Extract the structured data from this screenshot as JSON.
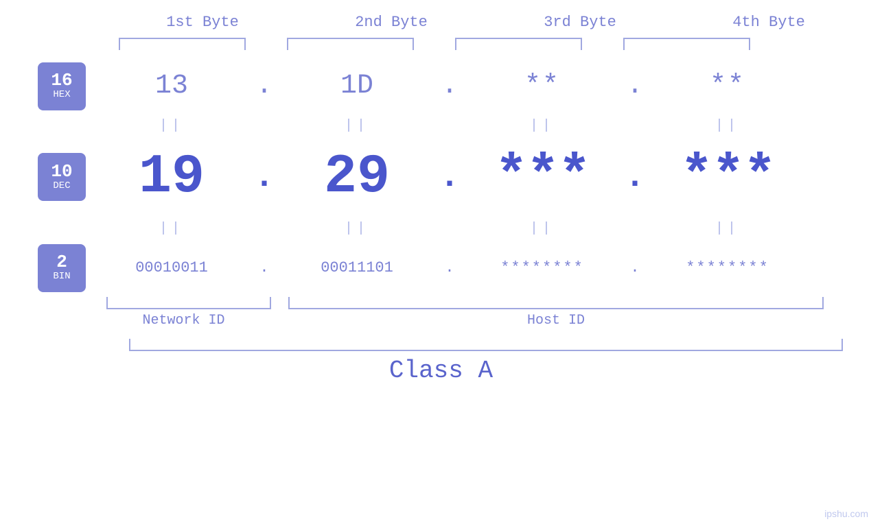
{
  "headers": {
    "byte1": "1st Byte",
    "byte2": "2nd Byte",
    "byte3": "3rd Byte",
    "byte4": "4th Byte"
  },
  "badges": {
    "hex": {
      "num": "16",
      "label": "HEX"
    },
    "dec": {
      "num": "10",
      "label": "DEC"
    },
    "bin": {
      "num": "2",
      "label": "BIN"
    }
  },
  "hex_row": {
    "b1": "13",
    "b2": "1D",
    "b3": "**",
    "b4": "**",
    "dot": "."
  },
  "dec_row": {
    "b1": "19",
    "b2": "29",
    "b3": "***",
    "b4": "***",
    "dot": "."
  },
  "bin_row": {
    "b1": "00010011",
    "b2": "00011101",
    "b3": "********",
    "b4": "********",
    "dot": "."
  },
  "labels": {
    "network_id": "Network ID",
    "host_id": "Host ID",
    "class": "Class A"
  },
  "watermark": "ipshu.com"
}
